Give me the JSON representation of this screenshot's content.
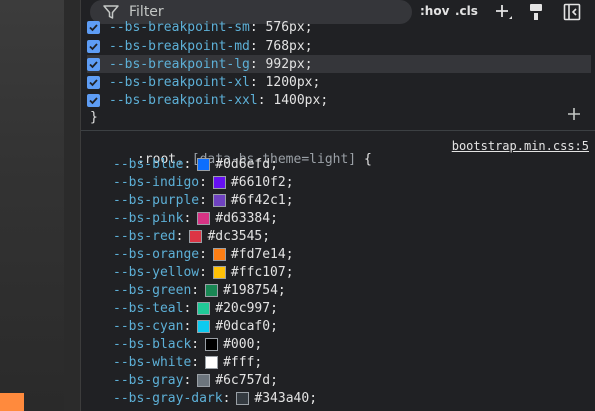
{
  "toolbar": {
    "filter_placeholder": "Filter",
    "hov_label": ":hov",
    "cls_label": ".cls"
  },
  "rule_breakpoints": {
    "declarations": [
      {
        "property": "--bs-breakpoint-sm",
        "value": "576px"
      },
      {
        "property": "--bs-breakpoint-md",
        "value": "768px"
      },
      {
        "property": "--bs-breakpoint-lg",
        "value": "992px"
      },
      {
        "property": "--bs-breakpoint-xl",
        "value": "1200px"
      },
      {
        "property": "--bs-breakpoint-xxl",
        "value": "1400px"
      }
    ],
    "closing_brace": "}"
  },
  "rule_root": {
    "selector": ":root",
    "selector_extra": "[data-bs-theme=light]",
    "open_brace": "{",
    "source": "bootstrap.min.css:5",
    "declarations": [
      {
        "property": "--bs-blue",
        "value": "#0d6efd",
        "color": "#0d6efd"
      },
      {
        "property": "--bs-indigo",
        "value": "#6610f2",
        "color": "#6610f2"
      },
      {
        "property": "--bs-purple",
        "value": "#6f42c1",
        "color": "#6f42c1"
      },
      {
        "property": "--bs-pink",
        "value": "#d63384",
        "color": "#d63384"
      },
      {
        "property": "--bs-red",
        "value": "#dc3545",
        "color": "#dc3545"
      },
      {
        "property": "--bs-orange",
        "value": "#fd7e14",
        "color": "#fd7e14"
      },
      {
        "property": "--bs-yellow",
        "value": "#ffc107",
        "color": "#ffc107"
      },
      {
        "property": "--bs-green",
        "value": "#198754",
        "color": "#198754"
      },
      {
        "property": "--bs-teal",
        "value": "#20c997",
        "color": "#20c997"
      },
      {
        "property": "--bs-cyan",
        "value": "#0dcaf0",
        "color": "#0dcaf0"
      },
      {
        "property": "--bs-black",
        "value": "#000",
        "color": "#000000"
      },
      {
        "property": "--bs-white",
        "value": "#fff",
        "color": "#ffffff"
      },
      {
        "property": "--bs-gray",
        "value": "#6c757d",
        "color": "#6c757d"
      },
      {
        "property": "--bs-gray-dark",
        "value": "#343a40",
        "color": "#343a40"
      }
    ]
  },
  "colors": {
    "accent": "#5e9df5",
    "property": "#5db0d7",
    "preview_orange": "#ff8a3d"
  }
}
